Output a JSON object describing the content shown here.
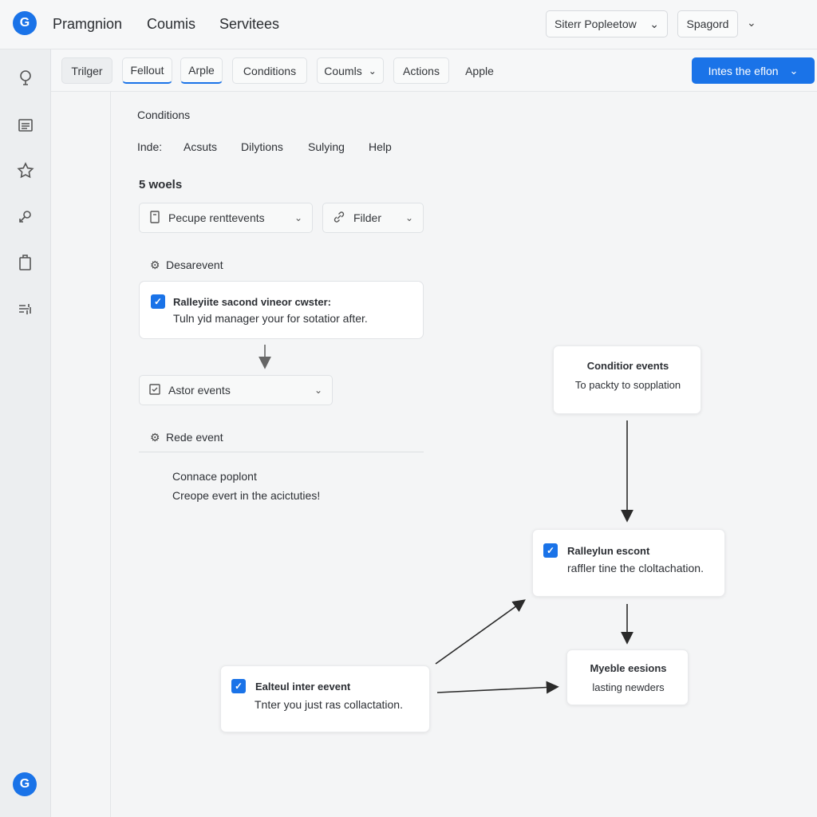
{
  "header": {
    "nav": [
      "Pramgnion",
      "Coumis",
      "Servitees"
    ],
    "select1": "Siterr Popleetow",
    "select2": "Spagord"
  },
  "tabs": [
    "Trilger",
    "Fellout",
    "Arple",
    "Conditions",
    "Coumls",
    "Actions",
    "Apple"
  ],
  "primary_button": "Intes the eflon",
  "panel": {
    "title": "Conditions",
    "subnav": [
      "Inde:",
      "Acsuts",
      "Dilytions",
      "Sulying",
      "Help"
    ],
    "count": "5 woels",
    "select_left": "Pecupe renttevents",
    "select_right": "Filder",
    "section1": "Desarevent",
    "card1_title": "Ralleyiite sacond vineor cwster:",
    "card1_body": "Tuln yid manager your for sotatior after.",
    "select_event": "Astor events",
    "section2": "Rede event",
    "note_line1": "Connace poplont",
    "note_line2": "Creope evert in the acictuties!"
  },
  "flow": {
    "node_condition_title": "Conditior events",
    "node_condition_body": "To packty to sopplation",
    "node_rally_title": "Ralleylun escont",
    "node_rally_body": "raffler tine the cloltachation.",
    "node_myeble_title": "Myeble eesions",
    "node_myeble_body": "lasting newders",
    "node_inter_title": "Ealteul inter eevent",
    "node_inter_body": "Tnter you just ras collactation."
  },
  "colors": {
    "accent": "#1a73e8"
  },
  "icons": {
    "rail": [
      "pin-icon",
      "list-icon",
      "star-icon",
      "branch-icon",
      "clipboard-icon",
      "filter-icon"
    ],
    "chevron": "chevron-down-icon",
    "checkbox": "checkbox-icon"
  }
}
